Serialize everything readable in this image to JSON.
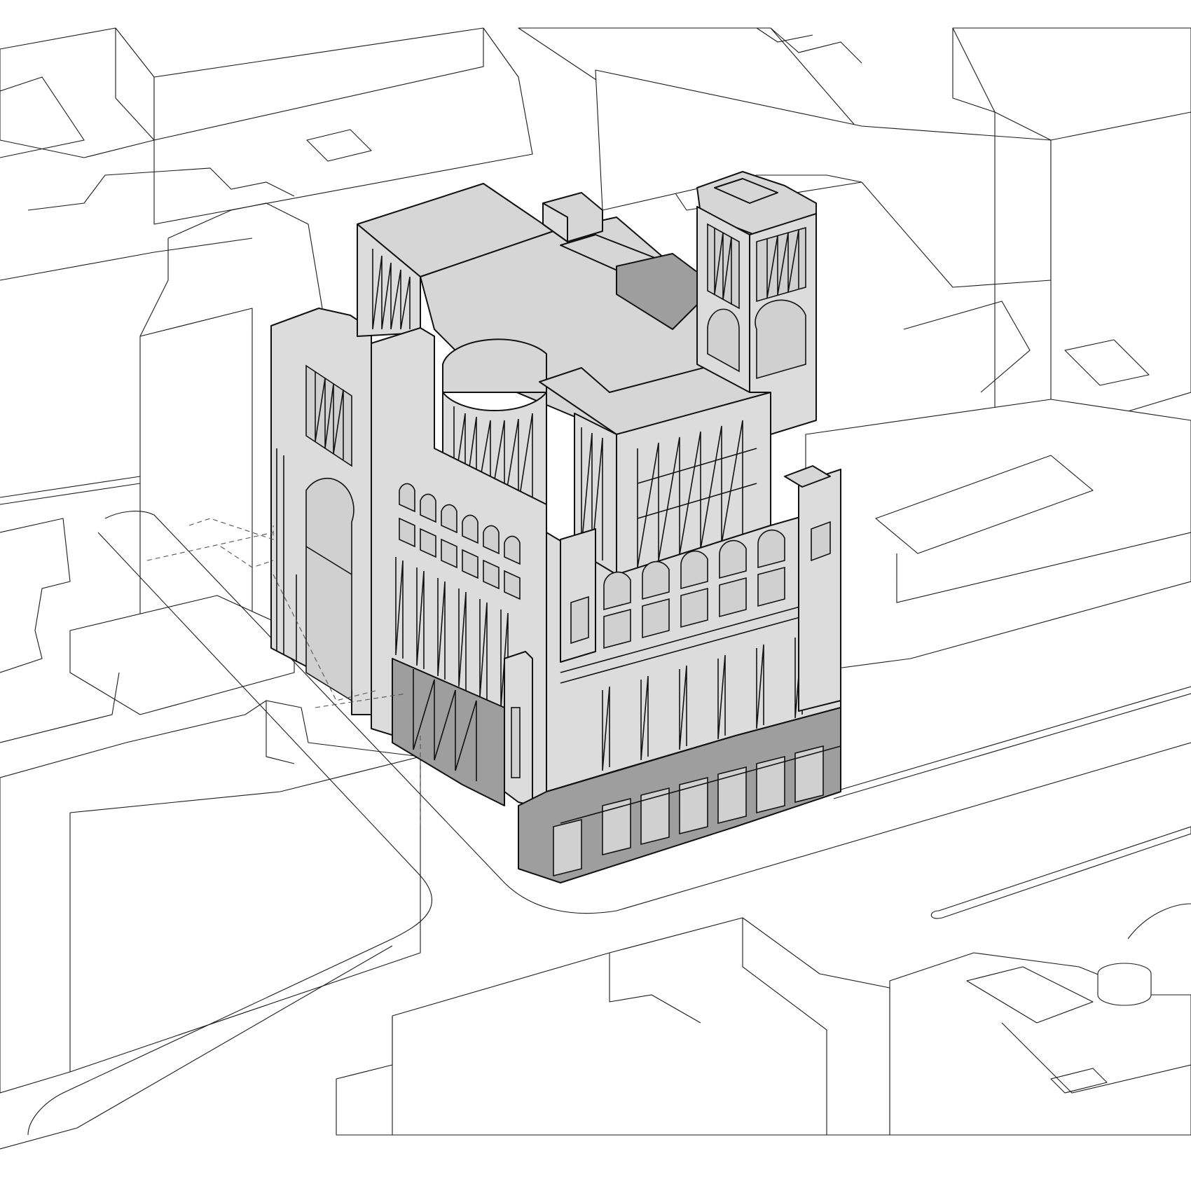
{
  "figure": {
    "kind": "axonometric-architectural-drawing",
    "colors": {
      "background": "#ffffff",
      "context_fill": "#ffffff",
      "highlight_fill": "#dcdcdc",
      "shadow_fill": "#9e9e9e",
      "linework": "#111111"
    }
  }
}
